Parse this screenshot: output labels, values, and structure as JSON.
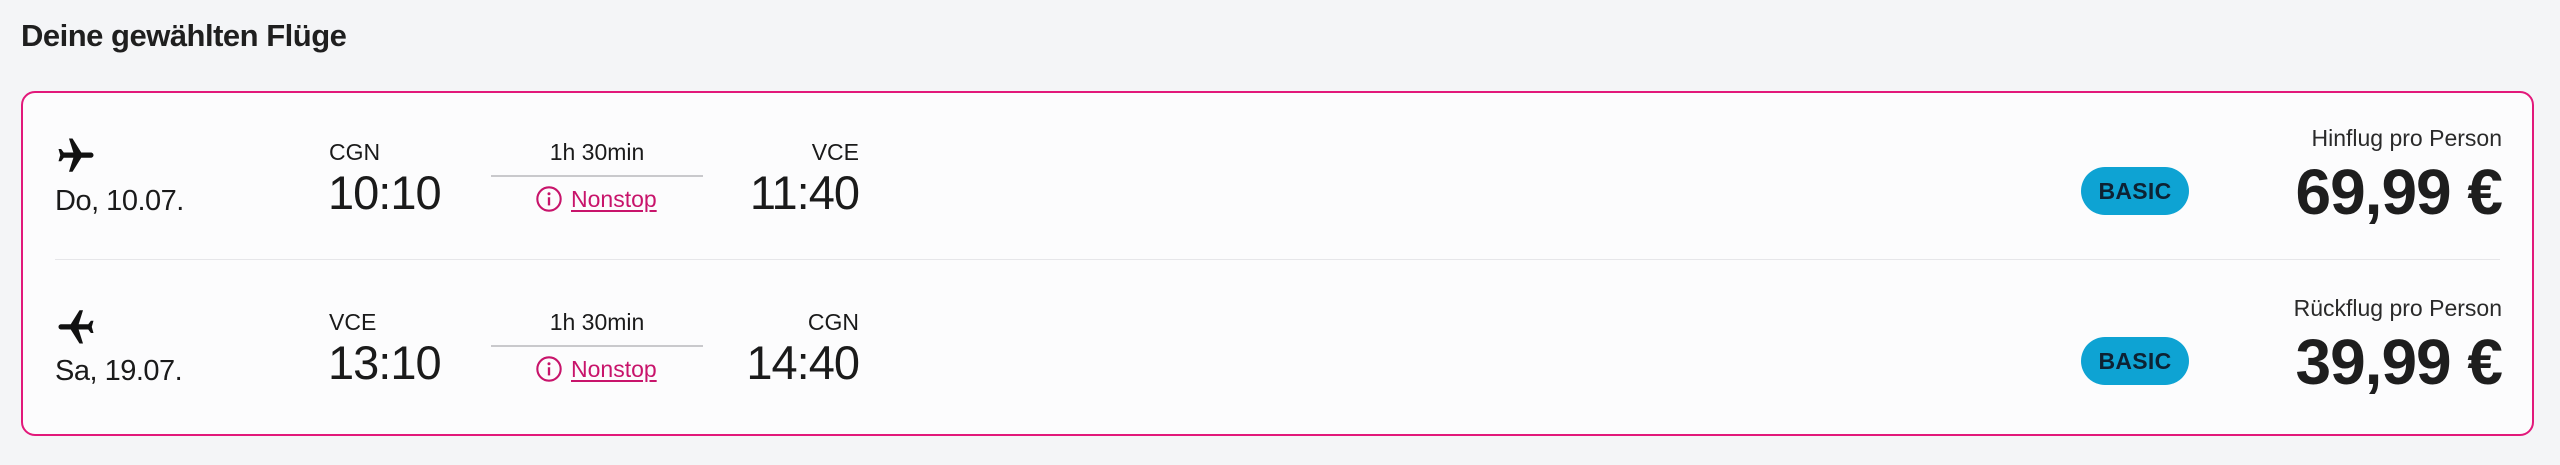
{
  "section": {
    "title": "Deine gewählten Flüge"
  },
  "flights": [
    {
      "direction_icon": "plane-departure-icon",
      "date": "Do, 10.07.",
      "from_code": "CGN",
      "from_time": "10:10",
      "duration": "1h 30min",
      "stops": "Nonstop",
      "to_code": "VCE",
      "to_time": "11:40",
      "fare": "BASIC",
      "price_label": "Hinflug pro Person",
      "price": "69,99 €"
    },
    {
      "direction_icon": "plane-return-icon",
      "date": "Sa, 19.07.",
      "from_code": "VCE",
      "from_time": "13:10",
      "duration": "1h 30min",
      "stops": "Nonstop",
      "to_code": "CGN",
      "to_time": "14:40",
      "fare": "BASIC",
      "price_label": "Rückflug pro Person",
      "price": "39,99 €"
    }
  ],
  "colors": {
    "accent": "#e2187a",
    "link": "#c8146b",
    "badge": "#0ea3d3"
  }
}
